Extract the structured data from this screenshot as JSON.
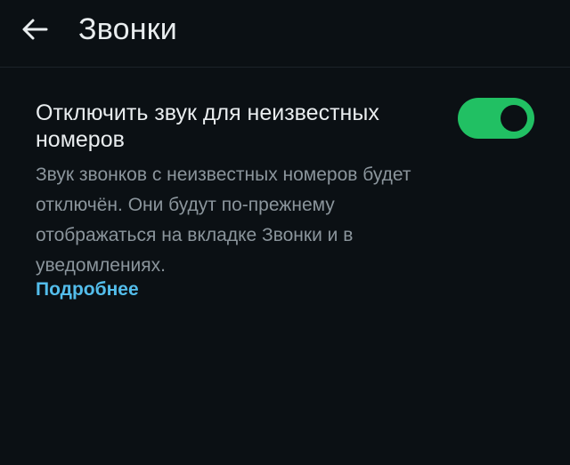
{
  "header": {
    "title": "Звонки",
    "back_icon": "arrow-left-icon"
  },
  "setting": {
    "title": "Отключить звук для неизвестных номеров",
    "description": "Звук звонков с неизвестных номеров будет отключён. Они будут по-прежнему отображаться на вкладке Звонки и в уведомлениях.",
    "learn_more": "Подробнее",
    "toggle_on": true
  },
  "colors": {
    "background": "#0b1014",
    "toggle_accent": "#21c063",
    "link": "#53bdeb",
    "primary_text": "#e9edef",
    "secondary_text": "#8b959c"
  }
}
